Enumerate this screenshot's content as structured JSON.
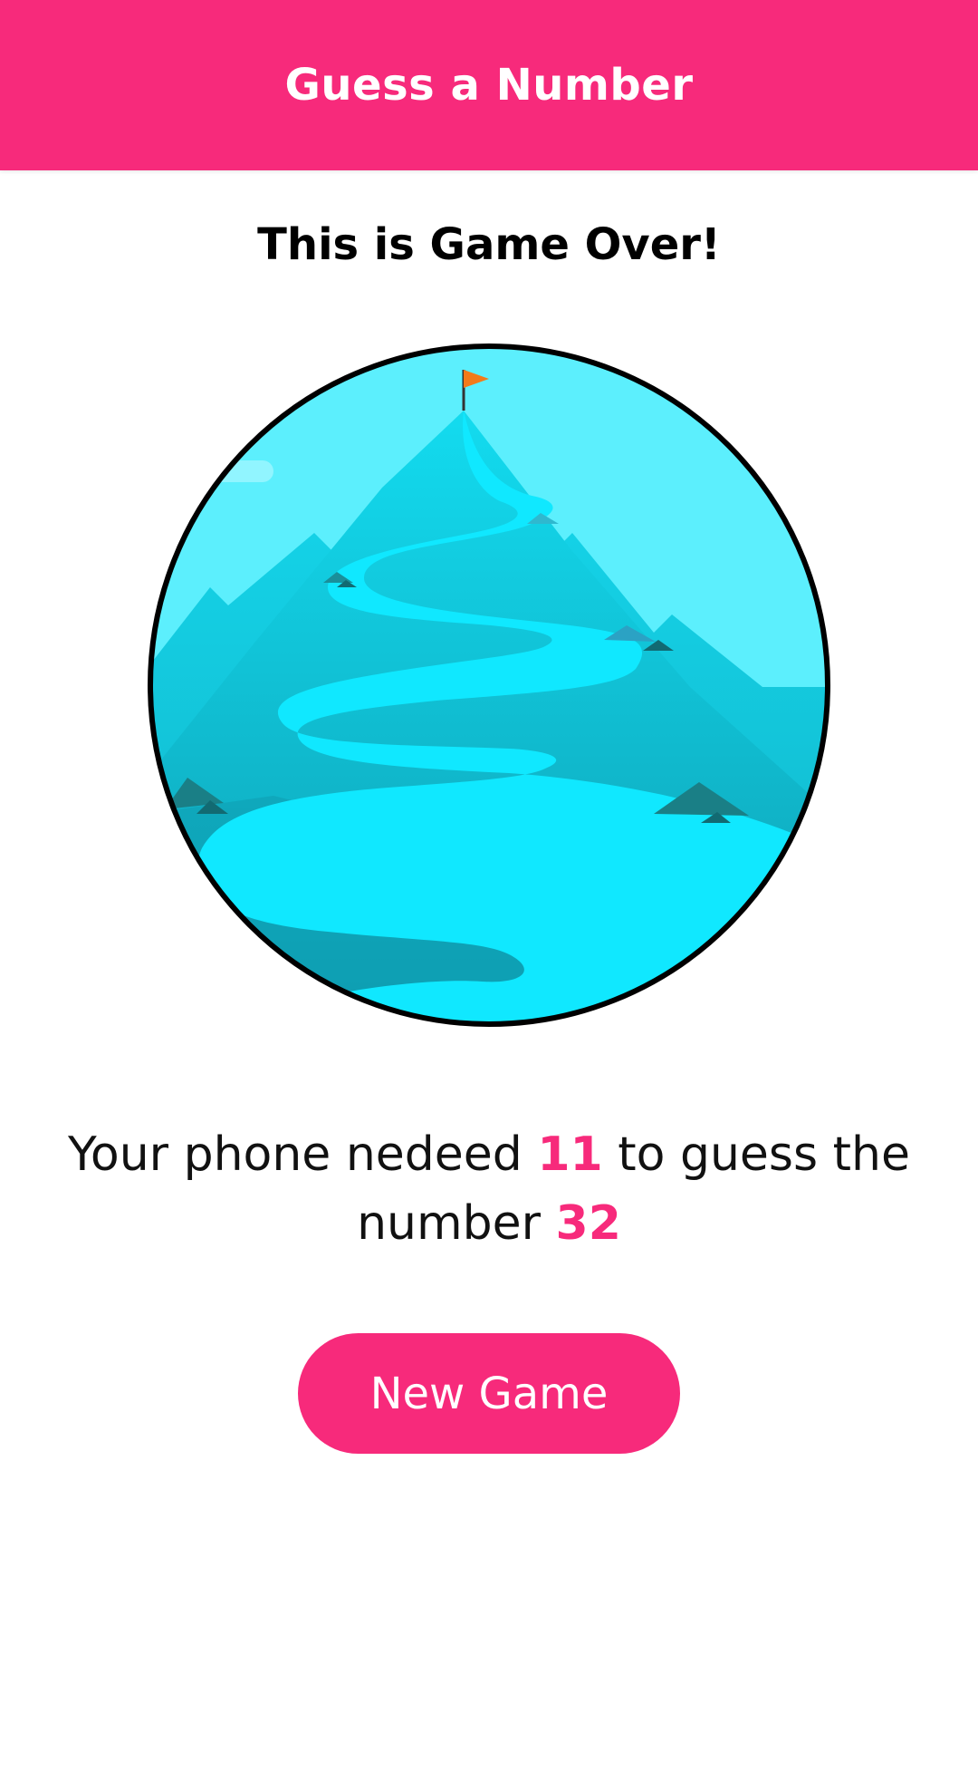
{
  "header": {
    "title": "Guess a Number"
  },
  "main": {
    "title": "This is Game Over!",
    "result": {
      "prefix": "Your phone nedeed ",
      "rounds": "11",
      "middle": " to guess the number ",
      "number": "32"
    },
    "new_game_label": "New Game"
  },
  "colors": {
    "accent": "#f72a7b",
    "sky": "#5ceffd",
    "river": "#10e8ff"
  },
  "icons": {
    "illustration": "mountain-with-flag-and-river"
  }
}
